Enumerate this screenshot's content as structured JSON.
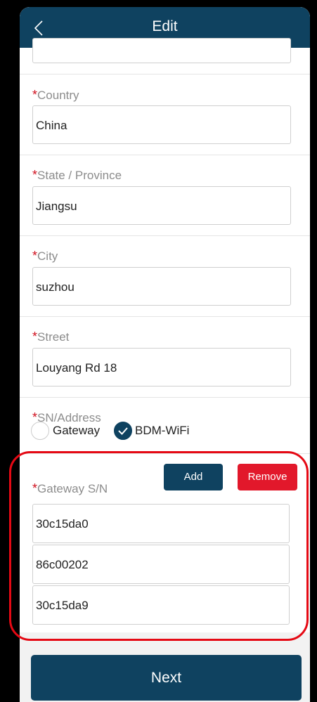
{
  "header": {
    "title": "Edit",
    "back_icon": "chevron-left-icon"
  },
  "form": {
    "required_mark": "*",
    "country": {
      "label": "Country",
      "value": "China"
    },
    "state": {
      "label": "State / Province",
      "value": "Jiangsu"
    },
    "city": {
      "label": "City",
      "value": "suzhou"
    },
    "street": {
      "label": "Street",
      "value": "Louyang Rd 18"
    },
    "sn_address": {
      "label": "SN/Address",
      "options": [
        {
          "label": "Gateway",
          "selected": false
        },
        {
          "label": "BDM-WiFi",
          "selected": true
        }
      ]
    },
    "gateway_sn": {
      "label": "Gateway S/N",
      "add_label": "Add",
      "remove_label": "Remove",
      "values": [
        "30c15da0",
        "86c00202",
        "30c15da9"
      ]
    }
  },
  "next_label": "Next",
  "colors": {
    "primary": "#0f4260",
    "danger": "#e2182b",
    "required": "#d0101e",
    "annotation": "#e50914"
  }
}
